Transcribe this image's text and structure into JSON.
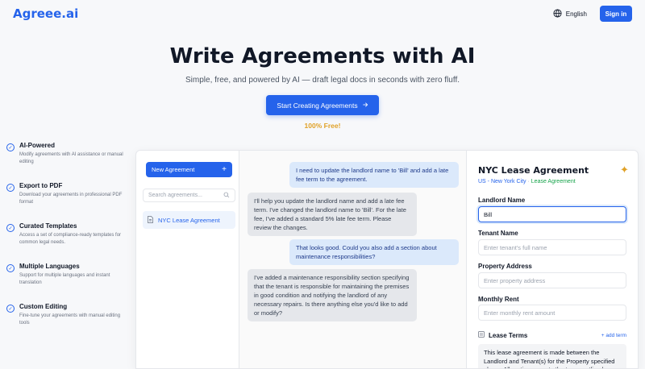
{
  "header": {
    "logo": "Agreee.ai",
    "language": "English",
    "signin": "Sign in"
  },
  "hero": {
    "title": "Write Agreements with AI",
    "subtitle": "Simple, free, and powered by AI — draft legal docs in seconds with zero fluff.",
    "cta": "Start Creating Agreements",
    "free_label": "100% Free!"
  },
  "features": [
    {
      "title": "AI-Powered",
      "desc": "Modify agreements with AI assistance or manual editing"
    },
    {
      "title": "Export to PDF",
      "desc": "Download your agreements in professional PDF format"
    },
    {
      "title": "Curated Templates",
      "desc": "Access a set of compliance-ready templates for common legal needs."
    },
    {
      "title": "Multiple Languages",
      "desc": "Support for multiple languages and instant translation"
    },
    {
      "title": "Custom Editing",
      "desc": "Fine-tune your agreements with manual editing tools"
    }
  ],
  "sidebar": {
    "new_button": "New Agreement",
    "search_placeholder": "Search agreements...",
    "items": [
      "NYC Lease Agreement"
    ]
  },
  "chat": [
    {
      "role": "user",
      "text": "I need to update the landlord name to 'Bill' and add a late fee term to the agreement."
    },
    {
      "role": "ai",
      "text": "I'll help you update the landlord name and add a late fee term. I've changed the landlord name to 'Bill'. For the late fee, I've added a standard 5% late fee term. Please review the changes."
    },
    {
      "role": "user",
      "text": "That looks good. Could you also add a section about maintenance responsibilities?"
    },
    {
      "role": "ai",
      "text": "I've added a maintenance responsibility section specifying that the tenant is responsible for maintaining the premises in good condition and notifying the landlord of any necessary repairs. Is there anything else you'd like to add or modify?"
    }
  ],
  "document": {
    "title": "NYC Lease Agreement",
    "country": "US - New York City",
    "separator": "·",
    "template": "Lease Agreement",
    "fields": [
      {
        "label": "Landlord Name",
        "value": "Bill",
        "placeholder": ""
      },
      {
        "label": "Tenant Name",
        "value": "",
        "placeholder": "Enter tenant's full name"
      },
      {
        "label": "Property Address",
        "value": "",
        "placeholder": "Enter property address"
      },
      {
        "label": "Monthly Rent",
        "value": "",
        "placeholder": "Enter monthly rent amount"
      }
    ],
    "terms_label": "Lease Terms",
    "add_term": "+ add term",
    "terms_text": "This lease agreement is made between the Landlord and Tenant(s) for the Property specified above. All parties agree to the terms outlined"
  },
  "colors": {
    "accent": "#2563eb",
    "free": "#e0a127",
    "user_bubble": "#dbe9fb",
    "ai_bubble": "#e5e7eb"
  },
  "icons": {
    "language": "globe-icon",
    "cta": "arrow-right-icon",
    "feature": "check-circle-icon",
    "new": "plus-icon",
    "search": "search-icon",
    "doc": "document-icon",
    "ai": "sparkle-icon",
    "terms": "list-icon"
  }
}
